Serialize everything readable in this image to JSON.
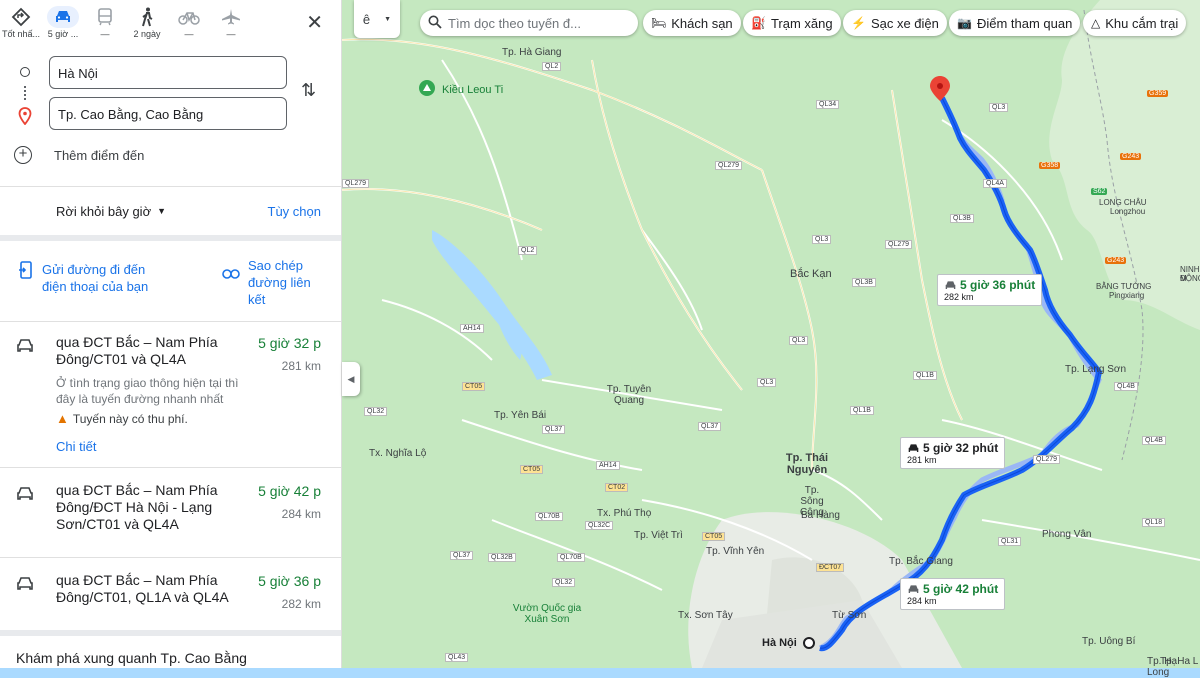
{
  "modes": [
    {
      "icon": "best-mode-icon",
      "label": "Tốt nhấ..."
    },
    {
      "icon": "car-icon",
      "label": "5 giờ ..."
    },
    {
      "icon": "transit-icon",
      "label": "—"
    },
    {
      "icon": "walk-icon",
      "label": "2 ngày"
    },
    {
      "icon": "bike-icon",
      "label": "—"
    },
    {
      "icon": "flight-icon",
      "label": "—"
    }
  ],
  "origin": "Hà Nội",
  "destination": "Tp. Cao Bằng, Cao Bằng",
  "add_destination": "Thêm điểm đến",
  "depart_label": "Rời khỏi bây giờ",
  "options_label": "Tùy chọn",
  "send_to_phone": "Gửi đường đi đến điện thoại của bạn",
  "copy_link": "Sao chép đường liên kết",
  "routes": [
    {
      "title": "qua ĐCT Bắc – Nam Phía Đông/CT01 và QL4A",
      "time": "5 giờ 32 p",
      "distance": "281 km",
      "desc": "Ở tình trạng giao thông hiện tại thì đây là tuyến đường nhanh nhất",
      "warning": "Tuyến này có thu phí.",
      "details": "Chi tiết"
    },
    {
      "title": "qua ĐCT Bắc – Nam Phía Đông/ĐCT Hà Nội - Lạng Sơn/CT01 và QL4A",
      "time": "5 giờ 42 p",
      "distance": "284 km"
    },
    {
      "title": "qua ĐCT Bắc – Nam Phía Đông/CT01, QL1A và QL4A",
      "time": "5 giờ 36 p",
      "distance": "282 km"
    }
  ],
  "explore": "Khám phá xung quanh Tp. Cao Bằng",
  "search_placeholder": "Tìm dọc theo tuyến đ...",
  "chips": [
    "Khách sạn",
    "Trạm xăng",
    "Sạc xe điện",
    "Điểm tham quan",
    "Khu cắm trại"
  ],
  "callouts": [
    {
      "time": "5 giờ 36 phút",
      "distance": "282 km"
    },
    {
      "time": "5 giờ 32 phút",
      "distance": "281 km"
    },
    {
      "time": "5 giờ 42 phút",
      "distance": "284 km"
    }
  ],
  "map_labels": {
    "cities": [
      "Tp. Hà Giang",
      "Kiều Leou Ti",
      "Bắc Kạn",
      "Tp. Tuyên Quang",
      "Tp. Yên Bái",
      "Tx. Nghĩa Lộ",
      "Tp. Thái Nguyên",
      "Tp. Sông Công",
      "Ba Hàng",
      "Tx. Phú Thọ",
      "Tp. Việt Trì",
      "Tp. Vĩnh Yên",
      "Tp. Bắc Giang",
      "Tx. Sơn Tây",
      "Từ Sơn",
      "Hà Nội",
      "Vườn Quốc gia Xuân Sơn",
      "Tp. Lạng Sơn",
      "Phong Vân",
      "Tp. Uông Bí",
      "Tp. Hạ Long",
      "LONG CHÂU",
      "Longzhou",
      "BẰNG TƯỜNG",
      "Pingxiang",
      "NINH M",
      "ĐỘNG",
      "Tp. Ha L"
    ],
    "roads": [
      "QL2",
      "QL34",
      "QL3",
      "QL279",
      "QL4A",
      "QL3B",
      "QL2",
      "QL3",
      "QL279",
      "QL3B",
      "QL3",
      "AH14",
      "CT05",
      "QL32",
      "QL37",
      "QL3",
      "QL1B",
      "QL1B",
      "QL4B",
      "QL37",
      "CT05",
      "AH14",
      "CT02",
      "QL70B",
      "QL32C",
      "QL37",
      "QL32B",
      "QL70B",
      "CT05",
      "ĐCT07",
      "QL32",
      "QL279",
      "QL31",
      "QL4B",
      "QL43",
      "QL18",
      "QL279",
      "G359",
      "G358",
      "G243",
      "S62",
      "G243",
      "QL4B",
      "QL18",
      "QL31",
      "QL37",
      "CT07",
      "QL32"
    ]
  },
  "colors": {
    "route": "#1a63f5",
    "route_alt": "#9ab7f5",
    "accent": "#1a73e8",
    "green": "#188038"
  }
}
